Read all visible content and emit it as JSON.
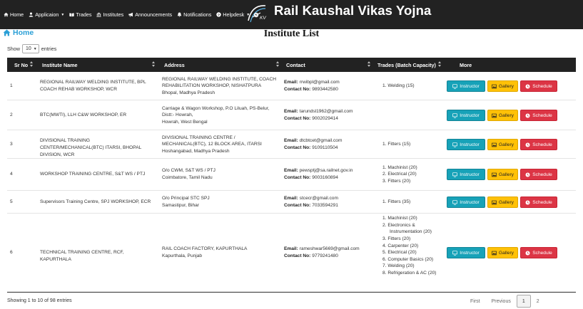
{
  "nav": {
    "items": [
      {
        "label": "Home",
        "icon": "home-icon"
      },
      {
        "label": "Applicaion",
        "icon": "user-icon",
        "dropdown": true
      },
      {
        "label": "Trades",
        "icon": "book-icon"
      },
      {
        "label": "Institutes",
        "icon": "building-icon"
      },
      {
        "label": "Announcements",
        "icon": "megaphone-icon"
      },
      {
        "label": "Notifications",
        "icon": "bell-icon"
      },
      {
        "label": "Helpdesk",
        "icon": "question-icon",
        "dropdown": true
      }
    ],
    "brand": "Rail Kaushal Vikas Yojna"
  },
  "breadcrumb": {
    "home": "Home"
  },
  "page_title": "Institute List",
  "show_entries": {
    "prefix": "Show",
    "value": "10",
    "suffix": "entries"
  },
  "table": {
    "headers": [
      "Sr No",
      "Institute Name",
      "Address",
      "Contact",
      "Trades (Batch Capacity)",
      "More"
    ],
    "email_label": "Email:",
    "contact_label": "Contact No:",
    "buttons": {
      "instructor": "Instructor",
      "gallery": "Gallery",
      "schedule": "Schedule"
    },
    "rows": [
      {
        "sr": "1",
        "name": "REGIONAL RAILWAY WELDING INSTITUTE, BPL COACH REHAB WORKSHOP, WCR",
        "address": [
          "REGIONAL RAILWAY WELDING INSTITUTE, COACH REHABILITATION WORKSHOP, NISHATPURA",
          "Bhopal, Madhya Pradesh"
        ],
        "email": "rrwibpl@gmail.com",
        "phone": "9893442580",
        "trades": [
          "1. Welding (15)"
        ]
      },
      {
        "sr": "2",
        "name": "BTC(MWTI), LLH C&W WORKSHOP, ER",
        "address": [
          "Carriage & Wagon Workshop, P.O Liluah, PS-Belur, Distt:- Howrah,",
          "Howrah, West Bengal"
        ],
        "email": "tarundsl1962@gmail.com",
        "phone": "9002029414",
        "trades": []
      },
      {
        "sr": "3",
        "name": "DIVISIONAL TRAINING CENTER/MECHANICAL(BTC) ITARSI, BHOPAL DIVISION, WCR",
        "address": [
          "DIVISIONAL TRAINING CENTRE / MECHANICAL(BTC), 12 BLOCK AREA, ITARSI",
          "Hoshangabad, Madhya Pradesh"
        ],
        "email": "dtcbtcet@gmail.com",
        "phone": "9109110504",
        "trades": [
          "1. Fitters (15)"
        ]
      },
      {
        "sr": "4",
        "name": "WORKSHOP TRAINING CENTRE, S&T WS / PTJ",
        "address": [
          "O/o CWM, S&T WS / PTJ",
          "Coimbatore, Tamil Nadu"
        ],
        "email": "pewsptj@sa.railnet.gov.in",
        "phone": "9003160894",
        "trades": [
          "1. Machinist (20)",
          "2. Electrical (20)",
          "3. Fitters (20)"
        ]
      },
      {
        "sr": "5",
        "name": "Supervisors Training Centre, SPJ WORKSHOP, ECR",
        "address": [
          "O/o Principal STC SPJ",
          "Samastipur, Bihar"
        ],
        "email": "stcecr@gmail.com",
        "phone": "7033594291",
        "trades": [
          "1. Fitters (35)"
        ]
      },
      {
        "sr": "6",
        "name": "TECHNICAL TRAINING CENTRE, RCF, KAPURTHALA",
        "address": [
          "RAIL COACH FACTORY, KAPURTHALA",
          "Kapurthala, Punjab"
        ],
        "email": "rameshwar5669@gmail.com",
        "phone": "9779241480",
        "trades": [
          "1. Machinist (20)",
          "2. Electronics & Instrumentation (20)",
          "3. Fitters (20)",
          "4. Carpenter (20)",
          "5. Electrical (20)",
          "6. Computer Basics (20)",
          "7. Welding (20)",
          "8. Refrigeration & AC (20)"
        ]
      }
    ]
  },
  "footer": {
    "info": "Showing 1 to 10 of 98 entries",
    "pager": [
      "First",
      "Previous",
      "1",
      "2"
    ],
    "active_page": "1"
  },
  "colors": {
    "navbar": "#222222",
    "link": "#2a9fd6",
    "instructor": "#17a2b8",
    "gallery": "#ffc107",
    "schedule": "#dc3545"
  }
}
